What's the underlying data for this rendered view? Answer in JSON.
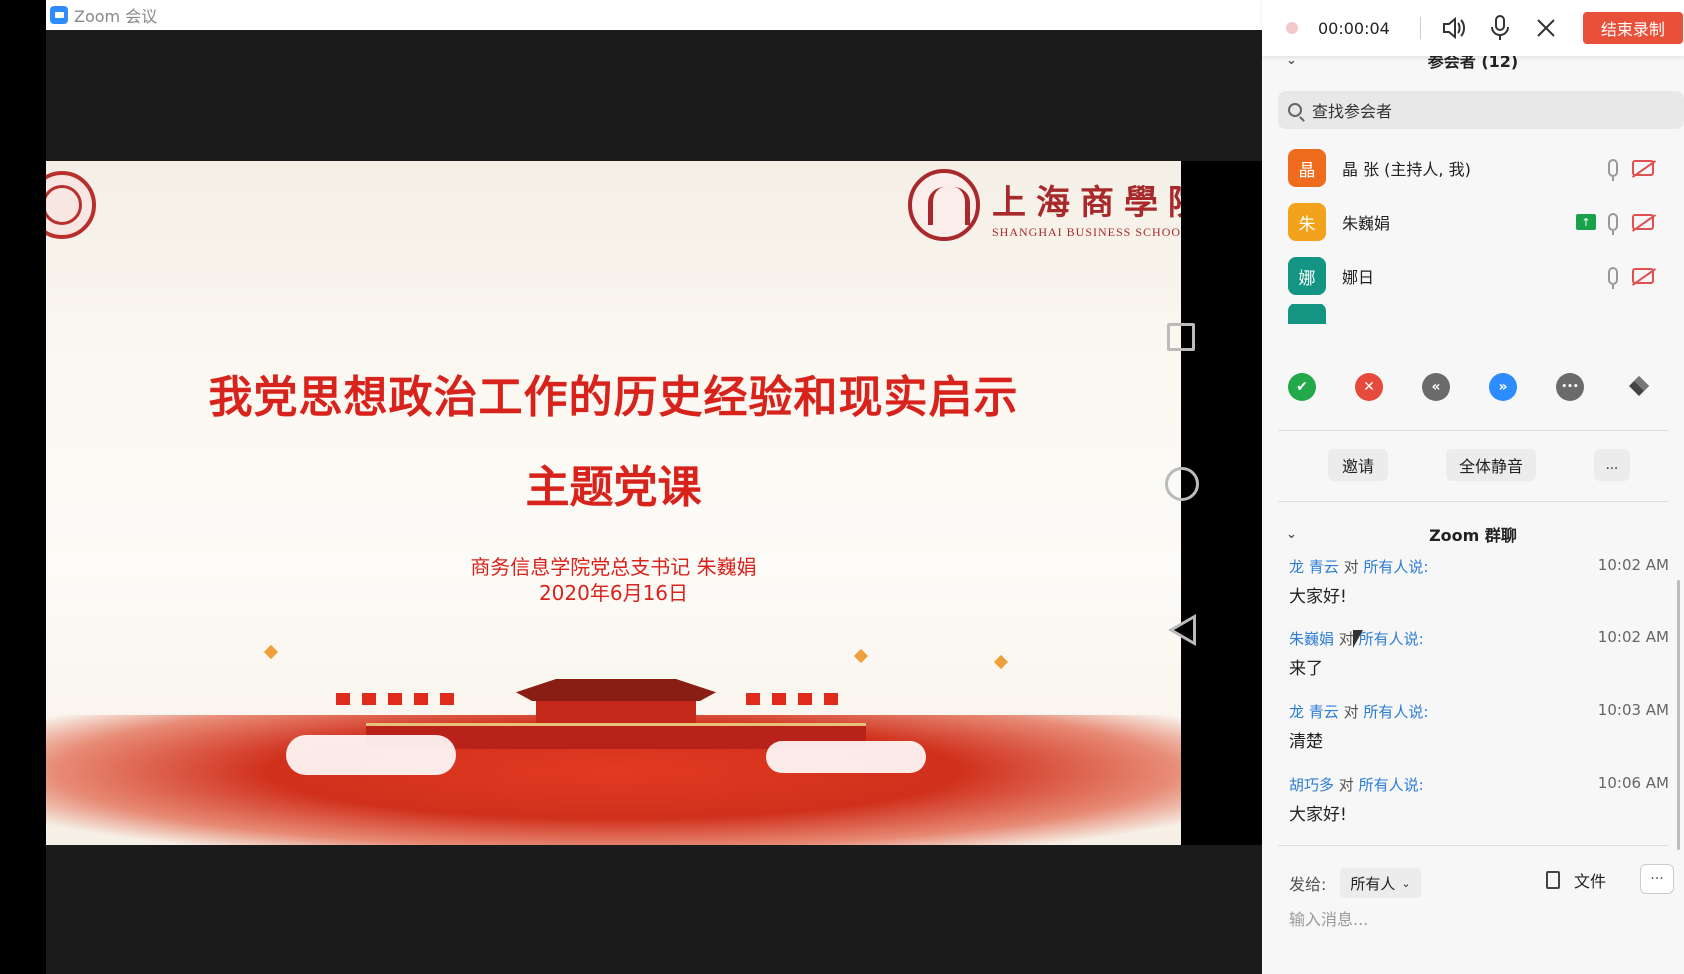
{
  "window": {
    "title": "Zoom 会议"
  },
  "slide": {
    "school_name_cn": "上海商學院",
    "school_name_en": "SHANGHAI BUSINESS SCHOOL",
    "title": "我党思想政治工作的历史经验和现实启示",
    "subtitle": "主题党课",
    "author": "商务信息学院党总支书记 朱巍娟",
    "date": "2020年6月16日"
  },
  "recording": {
    "time": "00:00:04",
    "stop_label": "结束录制"
  },
  "participants": {
    "header": "参会者 (12)",
    "search_placeholder": "查找参会者",
    "items": [
      {
        "avatar": "晶",
        "name": "晶 张 (主持人, 我)",
        "color": "#ef6c1f",
        "sharing": false
      },
      {
        "avatar": "朱",
        "name": "朱巍娟",
        "color": "#f3a21b",
        "sharing": true
      },
      {
        "avatar": "娜",
        "name": "娜日",
        "color": "#149483",
        "sharing": false
      }
    ],
    "invite_label": "邀请",
    "mute_all_label": "全体静音",
    "more_label": "..."
  },
  "reactions": [
    {
      "name": "yes",
      "symbol": "✔",
      "color": "#22a94a"
    },
    {
      "name": "no",
      "symbol": "✕",
      "color": "#e64a3c"
    },
    {
      "name": "slower",
      "symbol": "«",
      "color": "#6b6b6b"
    },
    {
      "name": "faster",
      "symbol": "»",
      "color": "#2d8cff"
    },
    {
      "name": "more",
      "symbol": "•••",
      "color": "#6b6b6b"
    }
  ],
  "chat": {
    "header": "Zoom 群聊",
    "messages": [
      {
        "sender": "龙 青云",
        "to_text": "对",
        "recipient": "所有人说:",
        "time": "10:02 AM",
        "text": "大家好!"
      },
      {
        "sender": "朱巍娟",
        "to_text": "对",
        "recipient": "所有人说:",
        "time": "10:02 AM",
        "text": "来了"
      },
      {
        "sender": "龙 青云",
        "to_text": "对",
        "recipient": "所有人说:",
        "time": "10:03 AM",
        "text": "清楚"
      },
      {
        "sender": "胡巧多",
        "to_text": "对",
        "recipient": "所有人说:",
        "time": "10:06 AM",
        "text": "大家好!"
      }
    ],
    "send_to_label": "发给:",
    "send_to_value": "所有人",
    "file_label": "文件",
    "more_label": "···",
    "input_placeholder": "输入消息..."
  }
}
